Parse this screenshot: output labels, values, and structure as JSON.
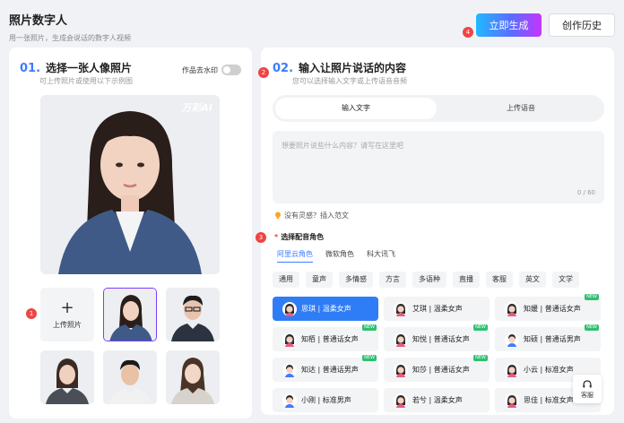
{
  "header": {
    "title": "照片数字人",
    "subtitle": "用一张照片，生成会说话的数字人视频",
    "generate_label": "立即生成",
    "history_label": "创作历史"
  },
  "badges": [
    "1",
    "2",
    "3",
    "4"
  ],
  "left": {
    "step_num": "01.",
    "step_title": "选择一张人像照片",
    "step_sub": "可上传照片或使用以下示例图",
    "watermark_label": "作品去水印",
    "watermark_on": false,
    "photo_logo": "万彩AI",
    "upload_label": "上传照片",
    "upload_plus": "+"
  },
  "right": {
    "step_num": "02.",
    "step_title": "输入让照片说话的内容",
    "step_sub": "您可以选择输入文字或上传语音音频",
    "tabs": [
      "输入文字",
      "上传语音"
    ],
    "text_placeholder": "想要照片说些什么内容？请写在这里吧",
    "counter": "0 / 60",
    "inspire_label": "没有灵感？插入范文",
    "voice_required_mark": "*",
    "voice_title": "选择配音角色",
    "vendor_tabs": [
      "阿里云角色",
      "微软角色",
      "科大讯飞"
    ],
    "style_chips": [
      "通用",
      "童声",
      "多情感",
      "方言",
      "多语种",
      "直播",
      "客服",
      "英文",
      "文学"
    ],
    "new_tag": "NEW",
    "voices": [
      {
        "label": "思琪 | 温柔女声",
        "new": false,
        "selected": true
      },
      {
        "label": "艾琪 | 温柔女声",
        "new": false,
        "selected": false
      },
      {
        "label": "知媛 | 普通话女声",
        "new": true,
        "selected": false
      },
      {
        "label": "知栢 | 普通话女声",
        "new": true,
        "selected": false
      },
      {
        "label": "知悦 | 普通话女声",
        "new": true,
        "selected": false
      },
      {
        "label": "知硕 | 普通话男声",
        "new": true,
        "selected": false
      },
      {
        "label": "知达 | 普通话男声",
        "new": true,
        "selected": false
      },
      {
        "label": "知莎 | 普通话女声",
        "new": true,
        "selected": false
      },
      {
        "label": "小云 | 标准女声",
        "new": false,
        "selected": false
      },
      {
        "label": "小刚 | 标准男声",
        "new": false,
        "selected": false
      },
      {
        "label": "若兮 | 温柔女声",
        "new": false,
        "selected": false
      },
      {
        "label": "思佳 | 标准女声",
        "new": false,
        "selected": false
      }
    ]
  },
  "service_label": "客服",
  "colors": {
    "accent": "#3d7bff",
    "selected_voice": "#2f7df6",
    "badge": "#f04444",
    "new_tag": "#2fbf71"
  }
}
